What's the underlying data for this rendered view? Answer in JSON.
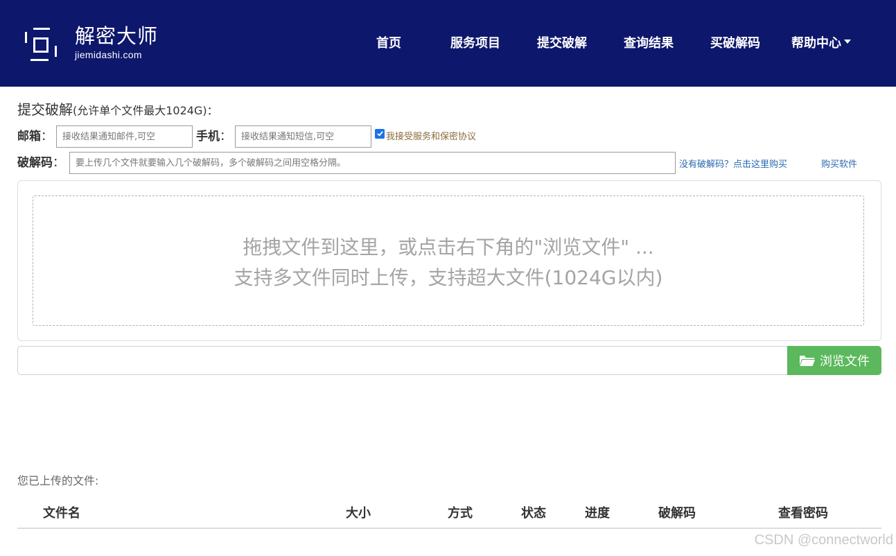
{
  "header": {
    "logo_cn": "解密大师",
    "logo_en": "jiemidashi.com",
    "background": "#0d176b",
    "nav": [
      {
        "label": "首页"
      },
      {
        "label": "服务项目"
      },
      {
        "label": "提交破解"
      },
      {
        "label": "查询结果"
      },
      {
        "label": "买破解码"
      },
      {
        "label": "帮助中心",
        "has_dropdown": true
      }
    ]
  },
  "form": {
    "title": "提交破解",
    "title_note": "(允许单个文件最大1024G)：",
    "email_label": "邮箱",
    "email_placeholder": "接收结果通知邮件,可空",
    "email_value": "",
    "phone_label": "手机",
    "phone_placeholder": "接收结果通知短信,可空",
    "phone_value": "",
    "agree_checked": true,
    "agree_text": "我接受服务和保密协议",
    "code_label": "破解码",
    "code_placeholder": "要上传几个文件就要输入几个破解码，多个破解码之间用空格分隔。",
    "code_value": "",
    "no_code_link": "没有破解码？点击这里购买",
    "buy_software_link": "购买软件"
  },
  "dropzone": {
    "line1": "拖拽文件到这里，或点击右下角的\"浏览文件\" ...",
    "line2": "支持多文件同时上传，支持超大文件(1024G以内)"
  },
  "browse": {
    "button_label": "浏览文件",
    "icon": "folder-open-icon",
    "color": "#5cb85c"
  },
  "uploaded": {
    "label": "您已上传的文件:",
    "columns": [
      "文件名",
      "大小",
      "方式",
      "状态",
      "进度",
      "破解码",
      "查看密码"
    ]
  },
  "watermark": "CSDN @connectworld"
}
